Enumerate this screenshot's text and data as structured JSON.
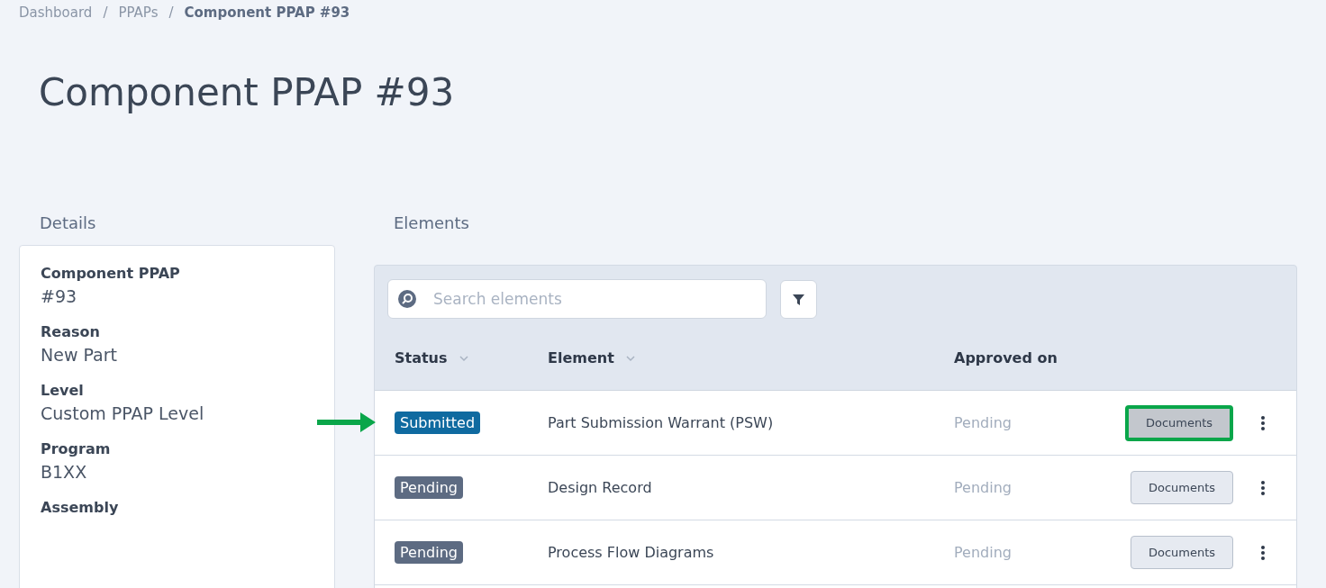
{
  "breadcrumb_separator": "/",
  "breadcrumb": [
    {
      "label": "Dashboard",
      "current": false
    },
    {
      "label": "PPAPs",
      "current": false
    },
    {
      "label": "Component PPAP #93",
      "current": true
    }
  ],
  "title": "Component PPAP #93",
  "details": {
    "heading": "Details",
    "fields": [
      {
        "label": "Component PPAP",
        "value": "#93"
      },
      {
        "label": "Reason",
        "value": "New Part"
      },
      {
        "label": "Level",
        "value": "Custom PPAP Level"
      },
      {
        "label": "Program",
        "value": "B1XX"
      },
      {
        "label": "Assembly"
      }
    ]
  },
  "elements": {
    "heading": "Elements",
    "search": {
      "placeholder": "Search elements"
    },
    "columns": [
      {
        "label": "Status",
        "sortable": true
      },
      {
        "label": "Element",
        "sortable": true
      },
      {
        "label": "Approved on"
      }
    ],
    "rows": [
      {
        "status": "Submitted",
        "kind": "submitted",
        "element": "Part Submission Warrant (PSW)",
        "approved_on": "Pending",
        "action": "Documents",
        "highlighted": true
      },
      {
        "status": "Pending",
        "kind": "pending",
        "element": "Design Record",
        "approved_on": "Pending",
        "action": "Documents",
        "highlighted": false
      },
      {
        "status": "Pending",
        "kind": "pending",
        "element": "Process Flow Diagrams",
        "approved_on": "Pending",
        "action": "Documents",
        "highlighted": false
      }
    ]
  }
}
